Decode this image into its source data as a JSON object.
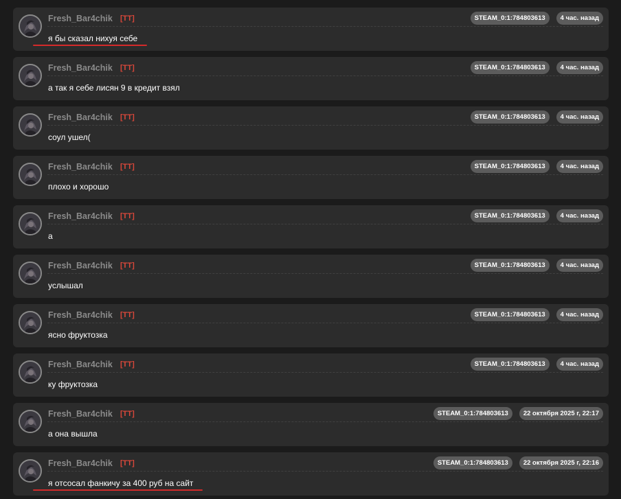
{
  "messages": [
    {
      "author": "Fresh_Bar4chik",
      "tag": "[TT]",
      "steam_id": "STEAM_0:1:784803613",
      "time": "4 час. назад",
      "text": "я бы сказал нихуя себе",
      "underlined": true
    },
    {
      "author": "Fresh_Bar4chik",
      "tag": "[TT]",
      "steam_id": "STEAM_0:1:784803613",
      "time": "4 час. назад",
      "text": "а так я себе лисян 9 в кредит взял",
      "underlined": false
    },
    {
      "author": "Fresh_Bar4chik",
      "tag": "[TT]",
      "steam_id": "STEAM_0:1:784803613",
      "time": "4 час. назад",
      "text": "соул ушел(",
      "underlined": false
    },
    {
      "author": "Fresh_Bar4chik",
      "tag": "[TT]",
      "steam_id": "STEAM_0:1:784803613",
      "time": "4 час. назад",
      "text": "плохо и хорошо",
      "underlined": false
    },
    {
      "author": "Fresh_Bar4chik",
      "tag": "[TT]",
      "steam_id": "STEAM_0:1:784803613",
      "time": "4 час. назад",
      "text": "а",
      "underlined": false
    },
    {
      "author": "Fresh_Bar4chik",
      "tag": "[TT]",
      "steam_id": "STEAM_0:1:784803613",
      "time": "4 час. назад",
      "text": "услышал",
      "underlined": false
    },
    {
      "author": "Fresh_Bar4chik",
      "tag": "[TT]",
      "steam_id": "STEAM_0:1:784803613",
      "time": "4 час. назад",
      "text": "ясно фруктозка",
      "underlined": false
    },
    {
      "author": "Fresh_Bar4chik",
      "tag": "[TT]",
      "steam_id": "STEAM_0:1:784803613",
      "time": "4 час. назад",
      "text": "ку фруктозка",
      "underlined": false
    },
    {
      "author": "Fresh_Bar4chik",
      "tag": "[TT]",
      "steam_id": "STEAM_0:1:784803613",
      "time": "22 октября 2025 г, 22:17",
      "text": "а она вышла",
      "underlined": false
    },
    {
      "author": "Fresh_Bar4chik",
      "tag": "[TT]",
      "steam_id": "STEAM_0:1:784803613",
      "time": "22 октября 2025 г, 22:16",
      "text": "я отсосал фанкичу за 400 руб на сайт",
      "underlined": true
    }
  ],
  "colors": {
    "background": "#1b1b1b",
    "card": "#2c2c2c",
    "author": "#8a8a8a",
    "tag": "#d9473a",
    "badge": "#5c5c5c",
    "text": "#ffffff",
    "annotation": "#d42a2a"
  },
  "icons": {
    "avatar": "user-avatar-icon"
  }
}
